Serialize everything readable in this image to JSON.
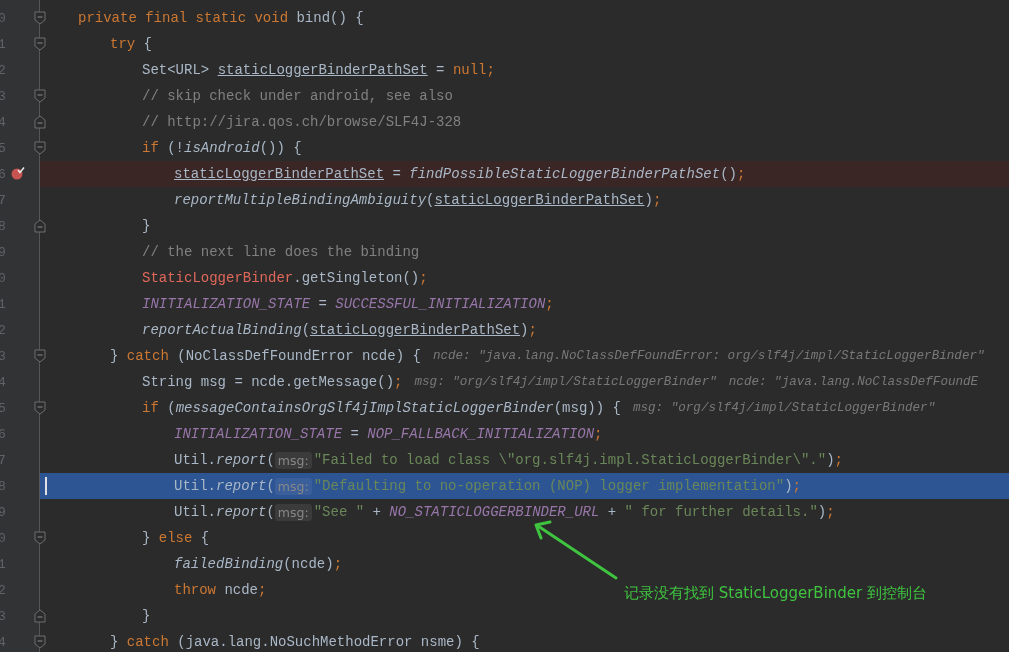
{
  "editor": {
    "lines": [
      {
        "number": "0",
        "fold_start": true,
        "tokens": [
          {
            "kind": "kw",
            "text": "private final static void"
          },
          {
            "kind": "plain",
            "text": " bind() {"
          }
        ],
        "children": [
          {
            "number": "1",
            "fold_start": true,
            "tokens": [
              {
                "kind": "kw",
                "text": "try"
              },
              {
                "kind": "plain",
                "text": " {"
              }
            ],
            "children": [
              {
                "number": "2",
                "tokens": [
                  {
                    "kind": "plain",
                    "text": "Set<URL> "
                  },
                  {
                    "kind": "var",
                    "text": "staticLoggerBinderPathSet"
                  },
                  {
                    "kind": "plain",
                    "text": " = "
                  },
                  {
                    "kind": "kw",
                    "text": "null;"
                  }
                ]
              },
              {
                "number": "3",
                "fold_start": true,
                "tokens": [
                  {
                    "kind": "comment",
                    "text": "// skip check under android, see also"
                  }
                ]
              },
              {
                "number": "4",
                "fold_end": true,
                "tokens": [
                  {
                    "kind": "comment",
                    "text": "// http://jira.qos.ch/browse/SLF4J-328"
                  }
                ]
              },
              {
                "number": "5",
                "fold_start": true,
                "tokens": [
                  {
                    "kind": "kw",
                    "text": "if"
                  },
                  {
                    "kind": "plain",
                    "text": " (!"
                  },
                  {
                    "kind": "call",
                    "text": "isAndroid"
                  },
                  {
                    "kind": "plain",
                    "text": "()) {"
                  }
                ],
                "children": [
                  {
                    "number": "6",
                    "breakpoint": true,
                    "tokens": [
                      {
                        "kind": "var",
                        "text": "staticLoggerBinderPathSet"
                      },
                      {
                        "kind": "plain",
                        "text": " = "
                      },
                      {
                        "kind": "call",
                        "text": "findPossibleStaticLoggerBinderPathSet"
                      },
                      {
                        "kind": "plain",
                        "text": "()"
                      },
                      {
                        "kind": "kw",
                        "text": ";"
                      }
                    ]
                  },
                  {
                    "number": "7",
                    "tokens": [
                      {
                        "kind": "call",
                        "text": "reportMultipleBindingAmbiguity"
                      },
                      {
                        "kind": "plain",
                        "text": "("
                      },
                      {
                        "kind": "var",
                        "text": "staticLoggerBinderPathSet"
                      },
                      {
                        "kind": "plain",
                        "text": ")"
                      },
                      {
                        "kind": "kw",
                        "text": ";"
                      }
                    ]
                  }
                ]
              },
              {
                "number": "8",
                "fold_end": true,
                "tokens": [
                  {
                    "kind": "plain",
                    "text": "}"
                  }
                ]
              },
              {
                "number": "9",
                "tokens": [
                  {
                    "kind": "comment",
                    "text": "// the next line does the binding"
                  }
                ]
              },
              {
                "number": "0",
                "tokens": [
                  {
                    "kind": "cls",
                    "text": "StaticLoggerBinder"
                  },
                  {
                    "kind": "plain",
                    "text": ".getSingleton()"
                  },
                  {
                    "kind": "kw",
                    "text": ";"
                  }
                ]
              },
              {
                "number": "1",
                "tokens": [
                  {
                    "kind": "static",
                    "text": "INITIALIZATION_STATE"
                  },
                  {
                    "kind": "plain",
                    "text": " = "
                  },
                  {
                    "kind": "static",
                    "text": "SUCCESSFUL_INITIALIZATION"
                  },
                  {
                    "kind": "kw",
                    "text": ";"
                  }
                ]
              },
              {
                "number": "2",
                "tokens": [
                  {
                    "kind": "call",
                    "text": "reportActualBinding"
                  },
                  {
                    "kind": "plain",
                    "text": "("
                  },
                  {
                    "kind": "var",
                    "text": "staticLoggerBinderPathSet"
                  },
                  {
                    "kind": "plain",
                    "text": ")"
                  },
                  {
                    "kind": "kw",
                    "text": ";"
                  }
                ]
              }
            ]
          },
          {
            "number": "3",
            "fold_start": true,
            "tokens": [
              {
                "kind": "plain",
                "text": "} "
              },
              {
                "kind": "kw",
                "text": "catch"
              },
              {
                "kind": "plain",
                "text": " (NoClassDefFoundError ncde) {"
              },
              {
                "kind": "debug",
                "text": "ncde: \"java.lang.NoClassDefFoundError: org/slf4j/impl/StaticLoggerBinder\""
              }
            ],
            "children": [
              {
                "number": "4",
                "tokens": [
                  {
                    "kind": "plain",
                    "text": "String msg = ncde.getMessage()"
                  },
                  {
                    "kind": "kw",
                    "text": ";"
                  },
                  {
                    "kind": "debug",
                    "text": "msg: \"org/slf4j/impl/StaticLoggerBinder\""
                  },
                  {
                    "kind": "debug",
                    "text": "ncde: \"java.lang.NoClassDefFoundE"
                  }
                ]
              },
              {
                "number": "5",
                "fold_start": true,
                "tokens": [
                  {
                    "kind": "kw",
                    "text": "if"
                  },
                  {
                    "kind": "plain",
                    "text": " ("
                  },
                  {
                    "kind": "call",
                    "text": "messageContainsOrgSlf4jImplStaticLoggerBinder"
                  },
                  {
                    "kind": "plain",
                    "text": "(msg)) {"
                  },
                  {
                    "kind": "debug",
                    "text": "msg: \"org/slf4j/impl/StaticLoggerBinder\""
                  }
                ],
                "children": [
                  {
                    "number": "6",
                    "tokens": [
                      {
                        "kind": "static",
                        "text": "INITIALIZATION_STATE"
                      },
                      {
                        "kind": "plain",
                        "text": " = "
                      },
                      {
                        "kind": "static",
                        "text": "NOP_FALLBACK_INITIALIZATION"
                      },
                      {
                        "kind": "kw",
                        "text": ";"
                      }
                    ]
                  },
                  {
                    "number": "7",
                    "tokens": [
                      {
                        "kind": "plain",
                        "text": "Util."
                      },
                      {
                        "kind": "call",
                        "text": "report"
                      },
                      {
                        "kind": "plain",
                        "text": "("
                      },
                      {
                        "kind": "param",
                        "text": "msg:"
                      },
                      {
                        "kind": "str",
                        "text": "\"Failed to load class \\\"org.slf4j.impl.StaticLoggerBinder\\\".\""
                      },
                      {
                        "kind": "plain",
                        "text": ")"
                      },
                      {
                        "kind": "kw",
                        "text": ";"
                      }
                    ]
                  },
                  {
                    "number": "8",
                    "current": true,
                    "tokens": [
                      {
                        "kind": "plain",
                        "text": "Util."
                      },
                      {
                        "kind": "call",
                        "text": "report"
                      },
                      {
                        "kind": "plain",
                        "text": "("
                      },
                      {
                        "kind": "param",
                        "text": "msg:"
                      },
                      {
                        "kind": "str",
                        "text": "\"Defaulting to no-operation (NOP) logger implementation\""
                      },
                      {
                        "kind": "plain",
                        "text": ")"
                      },
                      {
                        "kind": "kw",
                        "text": ";"
                      }
                    ]
                  },
                  {
                    "number": "9",
                    "tokens": [
                      {
                        "kind": "plain",
                        "text": "Util."
                      },
                      {
                        "kind": "call",
                        "text": "report"
                      },
                      {
                        "kind": "plain",
                        "text": "("
                      },
                      {
                        "kind": "param",
                        "text": "msg:"
                      },
                      {
                        "kind": "str",
                        "text": "\"See \""
                      },
                      {
                        "kind": "plain",
                        "text": " + "
                      },
                      {
                        "kind": "static",
                        "text": "NO_STATICLOGGERBINDER_URL"
                      },
                      {
                        "kind": "plain",
                        "text": " + "
                      },
                      {
                        "kind": "str",
                        "text": "\" for further details.\""
                      },
                      {
                        "kind": "plain",
                        "text": ")"
                      },
                      {
                        "kind": "kw",
                        "text": ";"
                      }
                    ]
                  }
                ]
              },
              {
                "number": "0",
                "fold_start": true,
                "tokens": [
                  {
                    "kind": "plain",
                    "text": "} "
                  },
                  {
                    "kind": "kw",
                    "text": "else"
                  },
                  {
                    "kind": "plain",
                    "text": " {"
                  }
                ],
                "children": [
                  {
                    "number": "1",
                    "tokens": [
                      {
                        "kind": "call",
                        "text": "failedBinding"
                      },
                      {
                        "kind": "plain",
                        "text": "(ncde)"
                      },
                      {
                        "kind": "kw",
                        "text": ";"
                      }
                    ]
                  },
                  {
                    "number": "2",
                    "tokens": [
                      {
                        "kind": "kw",
                        "text": "throw"
                      },
                      {
                        "kind": "plain",
                        "text": " ncde"
                      },
                      {
                        "kind": "kw",
                        "text": ";"
                      }
                    ]
                  }
                ]
              },
              {
                "number": "3",
                "fold_end": true,
                "tokens": [
                  {
                    "kind": "plain",
                    "text": "}"
                  }
                ]
              }
            ]
          },
          {
            "number": "4",
            "fold_start": true,
            "tokens": [
              {
                "kind": "plain",
                "text": "} "
              },
              {
                "kind": "kw",
                "text": "catch"
              },
              {
                "kind": "plain",
                "text": " (java.lang.NoSuchMethodError nsme) {"
              }
            ]
          }
        ]
      }
    ]
  },
  "annotation": {
    "text": "记录没有找到 StaticLoggerBinder 到控制台"
  }
}
